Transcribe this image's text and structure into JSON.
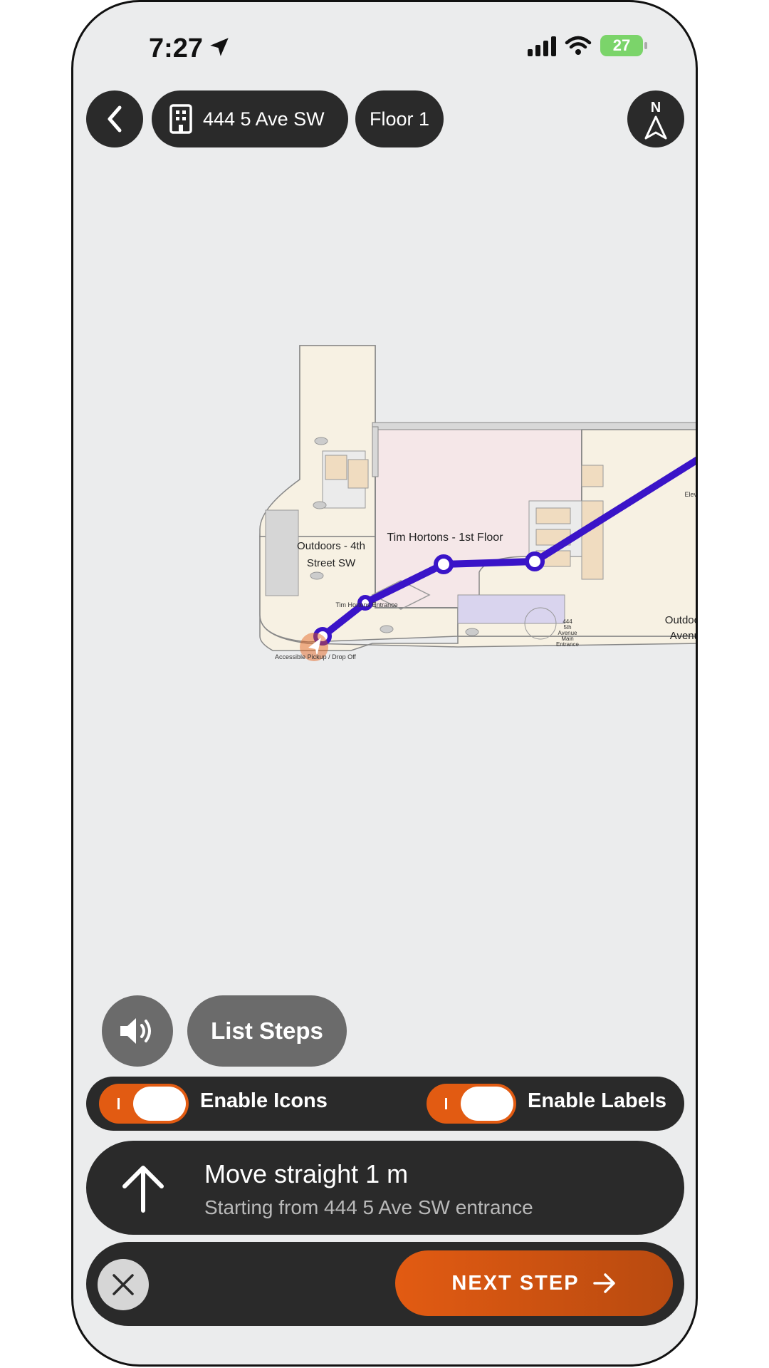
{
  "status": {
    "time": "7:27",
    "battery": "27"
  },
  "header": {
    "back_icon": "chevron-left-icon",
    "building_name": "444 5 Ave SW",
    "floor": "Floor 1",
    "compass_label": "N"
  },
  "map": {
    "labels": {
      "outdoors_4th_line1": "Outdoors - 4th",
      "outdoors_4th_line2": "Street SW",
      "tim_hortons": "Tim Hortons - 1st Floor",
      "tim_entrance": "Tim Hortons Entrance",
      "accessible_pickup": "Accessible Pickup / Drop Off",
      "elevator": "Elev",
      "outdoors_ave_line1": "Outdoo",
      "outdoors_ave_line2": "Avenu",
      "entrance_line1": "444",
      "entrance_line2": "5th",
      "entrance_line3": "Avenue",
      "entrance_line4": "Main",
      "entrance_line5": "Entrance"
    },
    "route_color": "#3a14c8"
  },
  "controls": {
    "list_steps": "List Steps",
    "enable_icons": "Enable Icons",
    "enable_labels": "Enable Labels",
    "icons_enabled": true,
    "labels_enabled": true
  },
  "step": {
    "title": "Move straight 1 m",
    "subtitle": "Starting from 444 5 Ave SW entrance"
  },
  "actions": {
    "next": "NEXT STEP"
  },
  "colors": {
    "accent": "#e25b12",
    "dark": "#2a2a2a",
    "route": "#3a14c8"
  }
}
